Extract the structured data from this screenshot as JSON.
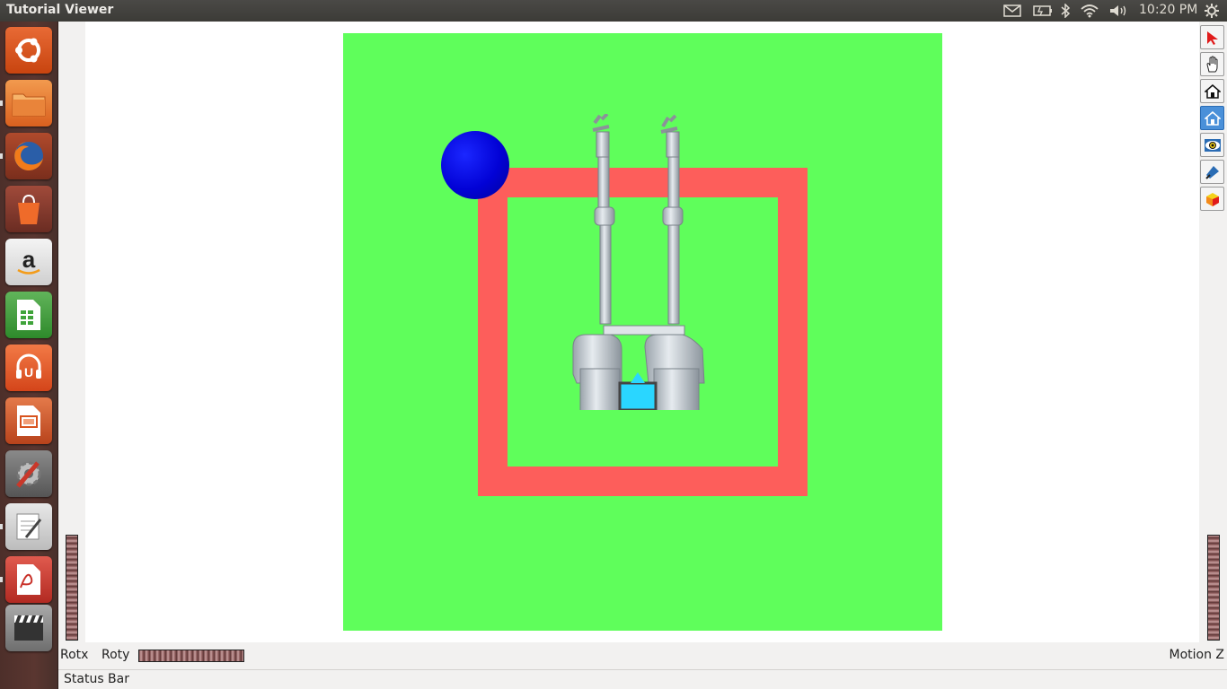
{
  "window": {
    "title": "Tutorial Viewer"
  },
  "top_panel": {
    "clock": "10:20 PM",
    "tray_icons": [
      "mail-icon",
      "battery-icon",
      "bluetooth-icon",
      "wifi-icon",
      "volume-icon",
      "settings-gear-icon"
    ]
  },
  "launcher": {
    "items": [
      {
        "name": "ubuntu-dash-icon",
        "color": "#dd4814"
      },
      {
        "name": "files-icon",
        "color": "#e2742e"
      },
      {
        "name": "firefox-icon",
        "color": "#e66000"
      },
      {
        "name": "software-center-icon",
        "color": "#e8541b"
      },
      {
        "name": "amazon-icon",
        "color": "#e6e6e6"
      },
      {
        "name": "libreoffice-calc-icon",
        "color": "#3fa33a"
      },
      {
        "name": "ubuntu-one-music-icon",
        "color": "#e5572a"
      },
      {
        "name": "libreoffice-impress-icon",
        "color": "#d8531e"
      },
      {
        "name": "system-settings-icon",
        "color": "#6d6d6d"
      },
      {
        "name": "text-editor-icon",
        "color": "#dedede"
      },
      {
        "name": "pdf-viewer-icon",
        "color": "#c9322a"
      },
      {
        "name": "clapperboard-icon",
        "color": "#3b3b3b"
      }
    ]
  },
  "scene": {
    "ground_color": "#5ffe5b",
    "boundary_color": "#fd5e5b",
    "sphere_color": "#0202d6"
  },
  "toolbar": {
    "tools": [
      "pick-arrow-icon",
      "hand-view-icon",
      "home-icon",
      "set-home-icon",
      "view-all-icon",
      "seek-icon",
      "projection-toggle-icon"
    ],
    "active": "set-home-icon"
  },
  "bottom": {
    "rotx_label": "Rotx",
    "roty_label": "Roty",
    "motion_label": "Motion Z",
    "status_text": "Status Bar"
  }
}
